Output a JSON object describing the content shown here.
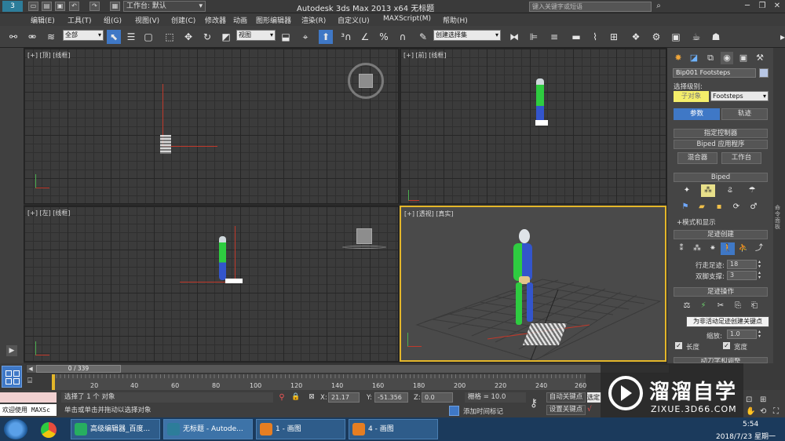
{
  "titlebar": {
    "workspace": "工作台: 默认",
    "title": "Autodesk 3ds Max  2013 x64      无标题",
    "search_placeholder": "键入关键字或短语"
  },
  "menus": [
    "编辑(E)",
    "工具(T)",
    "组(G)",
    "视图(V)",
    "创建(C)",
    "修改器",
    "动画",
    "图形编辑器",
    "渲染(R)",
    "自定义(U)",
    "MAXScript(M)",
    "帮助(H)"
  ],
  "toolbar": {
    "filter": "全部",
    "ref_coord": "视图",
    "named_sel": "创建选择集"
  },
  "viewports": {
    "top": {
      "label": "[+] [顶] [线框]"
    },
    "front": {
      "label": "[+] [前] [线框]"
    },
    "left": {
      "label": "[+] [左] [线框]"
    },
    "persp": {
      "label": "[+] [透视] [真实]"
    }
  },
  "panel": {
    "object_name": "Bip001 Footsteps",
    "sel_level_label": "选择级别:",
    "sub_object": "子对象",
    "sel_level": "Footsteps",
    "tab_params": "参数",
    "tab_track": "轨迹",
    "rollout_controller": "指定控制器",
    "rollout_biped_app": "Biped 应用程序",
    "btn_mixer": "混合器",
    "btn_workbench": "工作台",
    "rollout_biped": "Biped",
    "mode_display": "模式和显示",
    "rollout_footstep_create": "足迹创建",
    "walk_label": "行走足迹:",
    "walk_value": "18",
    "double_label": "双脚支撑:",
    "double_value": "3",
    "rollout_footstep_ops": "足迹操作",
    "tooltip": "为非活动足迹创建关键点",
    "scale_label": "缩放:",
    "scale_value": "1.0",
    "length_label": "长度",
    "width_label": "宽度",
    "rollout_dynamics": "动力学和调整",
    "side_label": "命令面板"
  },
  "timeline": {
    "frame": "0 / 339",
    "ticks": [
      "20",
      "40",
      "60",
      "80",
      "100",
      "120",
      "140",
      "160",
      "180",
      "200",
      "220",
      "240",
      "260"
    ]
  },
  "status": {
    "welcome": "欢迎使用 MAXSc",
    "selected": "选择了 1 个 对象",
    "hint": "单击或单击并拖动以选择对象",
    "x_label": "X:",
    "x": "21.17",
    "y_label": "Y:",
    "y": "-51.356",
    "z_label": "Z:",
    "z": "0.0",
    "grid": "栅格 = 10.0",
    "add_time_tag": "添加时间标记",
    "auto_key": "自动关键点",
    "set_key": "设置关键点",
    "selected_btn": "选定"
  },
  "taskbar": {
    "items": [
      "高级编辑器_百度...",
      "无标题 - Autode...",
      "1 - 画图",
      "4 - 画图"
    ],
    "time": "5:54",
    "date": "2018/7/23 星期一"
  },
  "watermark": {
    "brand": "溜溜自学",
    "url": "ZIXUE.3D66.COM"
  },
  "colors": {
    "accent": "#3f78c6",
    "active_viewport": "#e3b62a",
    "axis_red": "#c0392b",
    "biped_green": "#2ecc40",
    "biped_blue": "#3355cc"
  }
}
